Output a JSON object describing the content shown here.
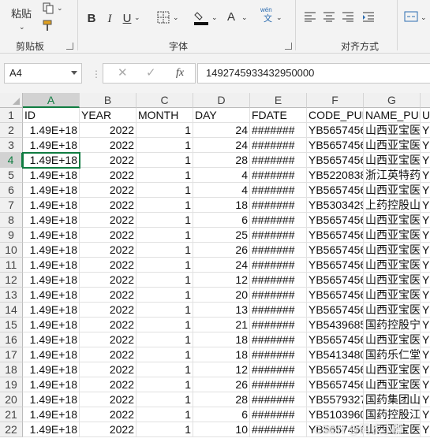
{
  "ribbon": {
    "paste_label": "粘贴",
    "clipboard_group": "剪贴板",
    "font_group": "字体",
    "alignment_group": "对齐方式",
    "bold": "B",
    "italic": "I",
    "underline": "U",
    "font_color_glyph": "A",
    "wen": "wén",
    "wen_char": "文"
  },
  "formula_bar": {
    "name_box": "A4",
    "fx": "fx",
    "cancel": "✕",
    "enter": "✓",
    "value": "1492745933432950000"
  },
  "columns": [
    "A",
    "B",
    "C",
    "D",
    "E",
    "F",
    "G"
  ],
  "rows": [
    {
      "n": "1",
      "a": "ID",
      "b": "YEAR",
      "c": "MONTH",
      "d": "DAY",
      "e": "FDATE",
      "f": "CODE_PUR",
      "g": "NAME_PUI",
      "h": "U"
    },
    {
      "n": "2",
      "a": "1.49E+18",
      "b": "2022",
      "c": "1",
      "d": "24",
      "e": "#######",
      "f": "YB5657456",
      "g": "山西亚宝医",
      "h": "Y"
    },
    {
      "n": "3",
      "a": "1.49E+18",
      "b": "2022",
      "c": "1",
      "d": "24",
      "e": "#######",
      "f": "YB5657456",
      "g": "山西亚宝医",
      "h": "Y"
    },
    {
      "n": "4",
      "a": "1.49E+18",
      "b": "2022",
      "c": "1",
      "d": "28",
      "e": "#######",
      "f": "YB5657456",
      "g": "山西亚宝医",
      "h": "Y"
    },
    {
      "n": "5",
      "a": "1.49E+18",
      "b": "2022",
      "c": "1",
      "d": "4",
      "e": "#######",
      "f": "YB5220838",
      "g": "浙江英特药",
      "h": "Y"
    },
    {
      "n": "6",
      "a": "1.49E+18",
      "b": "2022",
      "c": "1",
      "d": "4",
      "e": "#######",
      "f": "YB5657456",
      "g": "山西亚宝医",
      "h": "Y"
    },
    {
      "n": "7",
      "a": "1.49E+18",
      "b": "2022",
      "c": "1",
      "d": "18",
      "e": "#######",
      "f": "YB5303429",
      "g": "上药控股山",
      "h": "Y"
    },
    {
      "n": "8",
      "a": "1.49E+18",
      "b": "2022",
      "c": "1",
      "d": "6",
      "e": "#######",
      "f": "YB5657456",
      "g": "山西亚宝医",
      "h": "Y"
    },
    {
      "n": "9",
      "a": "1.49E+18",
      "b": "2022",
      "c": "1",
      "d": "25",
      "e": "#######",
      "f": "YB5657456",
      "g": "山西亚宝医",
      "h": "Y"
    },
    {
      "n": "10",
      "a": "1.49E+18",
      "b": "2022",
      "c": "1",
      "d": "26",
      "e": "#######",
      "f": "YB5657456",
      "g": "山西亚宝医",
      "h": "Y"
    },
    {
      "n": "11",
      "a": "1.49E+18",
      "b": "2022",
      "c": "1",
      "d": "24",
      "e": "#######",
      "f": "YB5657456",
      "g": "山西亚宝医",
      "h": "Y"
    },
    {
      "n": "12",
      "a": "1.49E+18",
      "b": "2022",
      "c": "1",
      "d": "12",
      "e": "#######",
      "f": "YB5657456",
      "g": "山西亚宝医",
      "h": "Y"
    },
    {
      "n": "13",
      "a": "1.49E+18",
      "b": "2022",
      "c": "1",
      "d": "20",
      "e": "#######",
      "f": "YB5657456",
      "g": "山西亚宝医",
      "h": "Y"
    },
    {
      "n": "14",
      "a": "1.49E+18",
      "b": "2022",
      "c": "1",
      "d": "13",
      "e": "#######",
      "f": "YB5657456",
      "g": "山西亚宝医",
      "h": "Y"
    },
    {
      "n": "15",
      "a": "1.49E+18",
      "b": "2022",
      "c": "1",
      "d": "21",
      "e": "#######",
      "f": "YB5439685",
      "g": "国药控股宁",
      "h": "Y"
    },
    {
      "n": "16",
      "a": "1.49E+18",
      "b": "2022",
      "c": "1",
      "d": "18",
      "e": "#######",
      "f": "YB5657456",
      "g": "山西亚宝医",
      "h": "Y"
    },
    {
      "n": "17",
      "a": "1.49E+18",
      "b": "2022",
      "c": "1",
      "d": "18",
      "e": "#######",
      "f": "YB5413480",
      "g": "国药乐仁堂",
      "h": "Y"
    },
    {
      "n": "18",
      "a": "1.49E+18",
      "b": "2022",
      "c": "1",
      "d": "12",
      "e": "#######",
      "f": "YB5657456",
      "g": "山西亚宝医",
      "h": "Y"
    },
    {
      "n": "19",
      "a": "1.49E+18",
      "b": "2022",
      "c": "1",
      "d": "26",
      "e": "#######",
      "f": "YB5657456",
      "g": "山西亚宝医",
      "h": "Y"
    },
    {
      "n": "20",
      "a": "1.49E+18",
      "b": "2022",
      "c": "1",
      "d": "28",
      "e": "#######",
      "f": "YB5579327",
      "g": "国药集团山",
      "h": "Y"
    },
    {
      "n": "21",
      "a": "1.49E+18",
      "b": "2022",
      "c": "1",
      "d": "6",
      "e": "#######",
      "f": "YB5103960",
      "g": "国药控股江",
      "h": "Y"
    },
    {
      "n": "22",
      "a": "1.49E+18",
      "b": "2022",
      "c": "1",
      "d": "10",
      "e": "#######",
      "f": "YB5657456",
      "g": "山西亚宝医",
      "h": "Y"
    }
  ],
  "watermark": "CSDN @码农小胖",
  "colors": {
    "accent": "#107c41"
  }
}
